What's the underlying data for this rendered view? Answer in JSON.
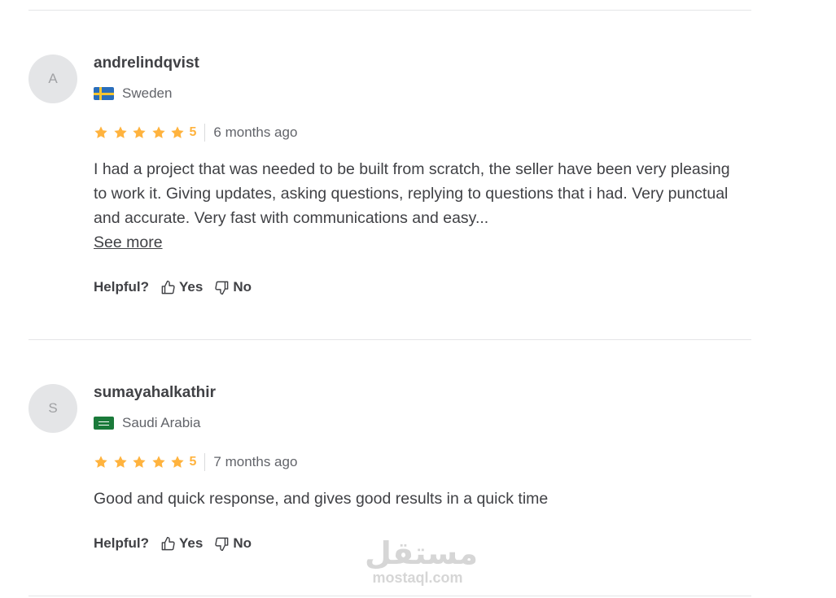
{
  "reviews": [
    {
      "avatar_initial": "A",
      "username": "andrelindqvist",
      "country": "Sweden",
      "flag_icon": "sweden-flag-icon",
      "rating": 5,
      "rating_label": "5",
      "time_ago": "6 months ago",
      "text": "I had a project that was needed to be built from scratch, the seller have been very pleasing to work it. Giving updates, asking questions, replying to questions that i had. Very punctual and accurate. Very fast with communications and easy...",
      "see_more_label": "See more",
      "helpful_label": "Helpful?",
      "yes_label": "Yes",
      "no_label": "No"
    },
    {
      "avatar_initial": "S",
      "username": "sumayahalkathir",
      "country": "Saudi Arabia",
      "flag_icon": "saudi-arabia-flag-icon",
      "rating": 5,
      "rating_label": "5",
      "time_ago": "7 months ago",
      "text": "Good and quick response, and gives good results in a quick time",
      "helpful_label": "Helpful?",
      "yes_label": "Yes",
      "no_label": "No"
    }
  ],
  "watermark": {
    "arabic": "مستقل",
    "latin": "mostaql.com"
  },
  "colors": {
    "star": "#ffb33e",
    "text": "#404145",
    "muted": "#62646a",
    "divider": "#e4e5e7",
    "avatar_bg": "#e4e5e7"
  }
}
